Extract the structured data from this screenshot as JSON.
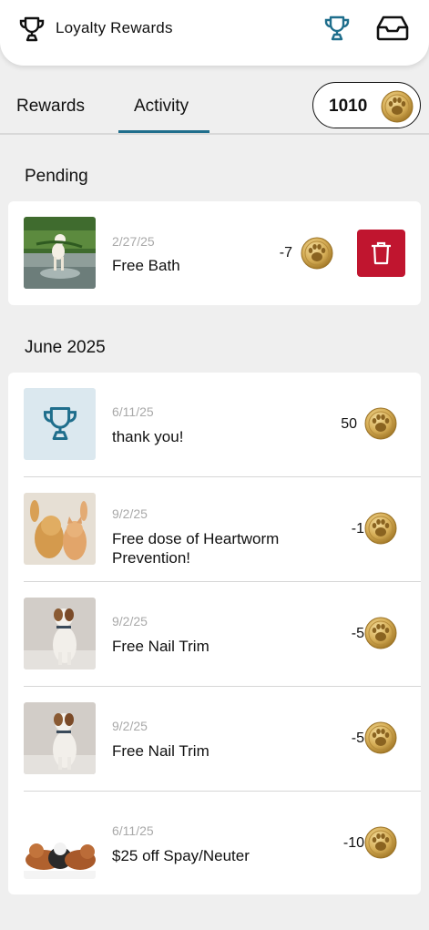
{
  "app": {
    "title": "Loyalty Rewards"
  },
  "tabs": {
    "rewards": "Rewards",
    "activity": "Activity",
    "active": "Activity"
  },
  "balance": {
    "points": "1010"
  },
  "colors": {
    "accent": "#1f6e8c",
    "delete": "#c0152f",
    "coin": "#d8b25a"
  },
  "pending": {
    "heading": "Pending",
    "items": [
      {
        "date": "2/27/25",
        "name": "Free Bath",
        "points": "-7",
        "image": "dog-puddle-photo",
        "action": "delete"
      }
    ]
  },
  "history": {
    "heading": "June 2025",
    "items": [
      {
        "date": "6/11/25",
        "name": "thank you!",
        "points": "50",
        "image": "trophy-icon"
      },
      {
        "date": "9/2/25",
        "name": "Free dose of Heartworm Prevention!",
        "points": "-1",
        "image": "dog-cat-photo"
      },
      {
        "date": "9/2/25",
        "name": "Free Nail Trim",
        "points": "-5",
        "image": "terrier-photo"
      },
      {
        "date": "9/2/25",
        "name": "Free Nail Trim",
        "points": "-5",
        "image": "terrier-photo"
      },
      {
        "date": "6/11/25",
        "name": "$25 off Spay/Neuter",
        "points": "-10",
        "image": "pets-lying-photo"
      }
    ]
  }
}
